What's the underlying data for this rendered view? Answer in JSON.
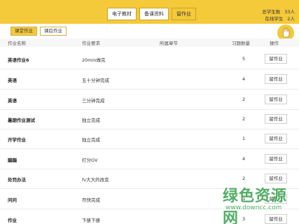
{
  "header": {
    "tabs": [
      {
        "label": "电子教材"
      },
      {
        "label": "备课资料"
      },
      {
        "label": "留作业"
      }
    ],
    "stats": [
      {
        "label": "总学生数",
        "value": "33人"
      },
      {
        "label": "在线学生",
        "value": "2人"
      }
    ]
  },
  "subtabs": [
    {
      "label": "课堂作业"
    },
    {
      "label": "课后作业"
    }
  ],
  "table": {
    "columns": [
      "作业名称",
      "作业要求",
      "所属章节",
      "习题数量",
      "操作"
    ],
    "rows": [
      {
        "name": "英语作业6",
        "req": "20min做完",
        "chapter": "",
        "count": "5",
        "op": "留作业"
      },
      {
        "name": "英语",
        "req": "五十分钟完成",
        "chapter": "",
        "count": "4",
        "op": "留作业"
      },
      {
        "name": "英语",
        "req": "三分钟完成",
        "chapter": "",
        "count": "2",
        "op": "留作业"
      },
      {
        "name": "暑期作业测试",
        "req": "独立完成",
        "chapter": "",
        "count": "2",
        "op": "留作业"
      },
      {
        "name": "开学作业",
        "req": "独立完成",
        "chapter": "",
        "count": "1",
        "op": "留作业"
      },
      {
        "name": "蹦蹦",
        "req": "打分GV",
        "chapter": "",
        "count": "4",
        "op": "留作业"
      },
      {
        "name": "处罚办法",
        "req": "fv大大的改变",
        "chapter": "",
        "count": "2",
        "op": "留作业"
      },
      {
        "name": "问问",
        "req": "尽快完成",
        "chapter": "",
        "count": "4",
        "op": "留作业"
      },
      {
        "name": "作业",
        "req": "下册下册",
        "chapter": "",
        "count": "3",
        "op": "留作业"
      }
    ]
  },
  "watermark": {
    "title": "绿色资源网",
    "url": "www.downcc.com"
  },
  "icons": {
    "hand": "hand-icon"
  },
  "colors": {
    "accent": "#f4c93a",
    "watermark": "#37a14c"
  }
}
